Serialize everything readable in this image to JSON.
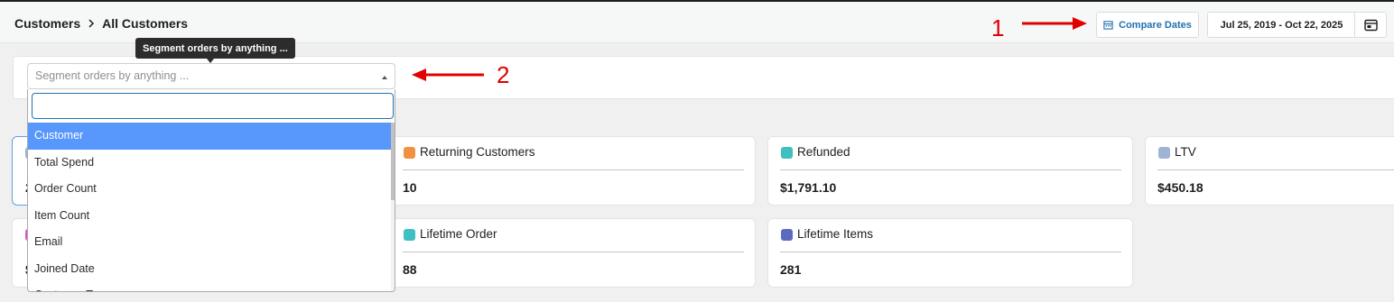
{
  "breadcrumb": {
    "parent": "Customers",
    "current": "All Customers"
  },
  "header": {
    "compare_label": "Compare Dates",
    "date_range": "Jul 25, 2019 - Oct 22, 2025",
    "icons": {
      "compare": "calendar-icon",
      "date_picker": "calendar-icon"
    }
  },
  "annotations": {
    "one": "1",
    "two": "2"
  },
  "segment": {
    "tooltip": "Segment orders by anything ...",
    "placeholder": "Segment orders by anything ...",
    "search_value": "",
    "options": [
      "Customer",
      "Total Spend",
      "Order Count",
      "Item Count",
      "Email",
      "Joined Date",
      "Customer Type"
    ],
    "active_option": "Customer"
  },
  "cards": {
    "returning": {
      "label": "Returning Customers",
      "value": "10",
      "color": "#f0913f"
    },
    "refunded": {
      "label": "Refunded",
      "value": "$1,791.10",
      "color": "#3fbfbf"
    },
    "ltv": {
      "label": "LTV",
      "value": "$450.18",
      "color": "#9fb4d4"
    },
    "lifetime_order": {
      "label": "Lifetime Order",
      "value": "88",
      "color": "#3fbfbf"
    },
    "lifetime_items": {
      "label": "Lifetime Items",
      "value": "281",
      "color": "#5c6bc0"
    },
    "hidden_one": {
      "value_fragment": "2",
      "color": "#9fb4d4"
    },
    "hidden_two": {
      "value_fragment": "$",
      "color": "#e84fcf"
    }
  },
  "colors": {
    "accent": "#2271b1",
    "annotation": "#e00000",
    "highlight": "#5897fb"
  }
}
